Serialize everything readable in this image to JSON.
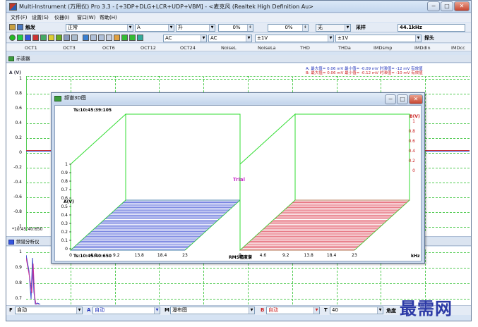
{
  "window": {
    "title": "Multi-Instrument (万用仪) Pro 3.3  -  [+3DP+DLG+LCR+UDP+VBM]  -  <麦克风 (Realtek High Definition Au>",
    "buttons": [
      "−",
      "□",
      "✕"
    ]
  },
  "menu": [
    "文件(F)",
    "设置(S)",
    "仪器(I)",
    "窗口(W)",
    "帮助(H)"
  ],
  "toolbar1": {
    "trigger_label": "触发",
    "mode": "正常",
    "channel": "A",
    "edge": "升",
    "level1": "0%",
    "level2": "0%",
    "none": "无",
    "sampling_label": "采样",
    "sample_rate": "44.1kHz"
  },
  "toolbar2": {
    "coupling_a": "AC",
    "coupling_b": "AC",
    "range_a": "±1V",
    "range_b": "±1V",
    "probe_label": "探头"
  },
  "measure_tabs": [
    "OCT1",
    "OCT3",
    "OCT6",
    "OCT12",
    "OCT24",
    "NoiseL",
    "NoiseLa",
    "THD",
    "THDa",
    "IMDsmp",
    "IMDdin",
    "IMDcc"
  ],
  "oscilloscope": {
    "title": "示波器",
    "y_axis_label": "A (V)",
    "y_ticks": [
      "1",
      "0.8",
      "0.6",
      "0.4",
      "0.2",
      "0",
      "-0.2",
      "-0.4",
      "-0.6",
      "-0.8",
      "-1"
    ],
    "timestamp": "*10:45:40:650",
    "readout_a": "A:  最大值=     0.06 mV  最小值=   -0.09 mV  时滞值=     -12 mV  有效值",
    "readout_b": "B:  最大值=     0.06 mV  最小值=   -0.12 mV  时滞值=     -10 mV  有效值"
  },
  "spectrum_panel": {
    "title": "频谱分析仪",
    "y_ticks": [
      "1",
      "0.9",
      "0.8",
      "0.7"
    ]
  },
  "dialog": {
    "title": "频谱3D图",
    "timestamp_top": "Ts:10:45:39:105",
    "timestamp_bottom": "Ts:10:45:40:650",
    "y_axis_label": "A(V)",
    "y_ticks_left": [
      "1",
      "0.9",
      "0.8",
      "0.7",
      "0.6",
      "0.5",
      "0.4",
      "0.3",
      "0.2",
      "0.1",
      "0"
    ],
    "x_ticks": [
      "0",
      "4.6",
      "9.2",
      "13.8",
      "18.4",
      "23"
    ],
    "mid_label": "RMS幅度谱",
    "unit_right": "kHz",
    "trial": "Trial",
    "right_axis_label": "B(V)",
    "right_ticks": [
      "1",
      "0.8",
      "0.6",
      "0.4",
      "0.2",
      "0"
    ],
    "colors": {
      "left_series": "#5060d8",
      "right_series": "#e05060",
      "frame": "#33dd33"
    }
  },
  "bottom": {
    "f_label": "F",
    "f_value": "自动",
    "a_label": "A",
    "a_value": "自动",
    "m_label": "M",
    "m_value": "瀑布图",
    "b_label": "B",
    "b_value": "自动",
    "t_label": "T",
    "t_value": "40",
    "angle_label": "角度"
  },
  "watermark": "最需网"
}
